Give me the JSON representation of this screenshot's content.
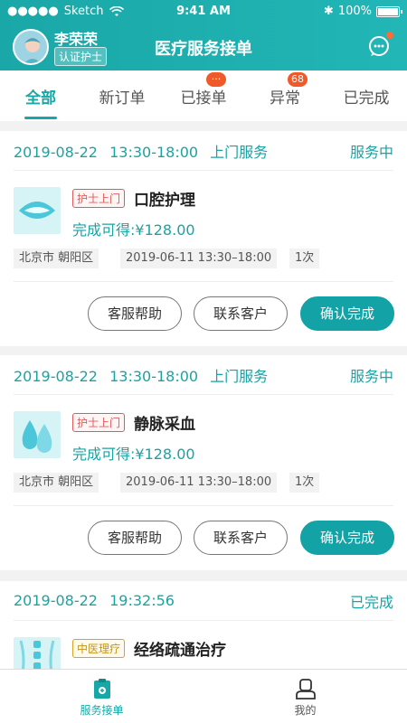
{
  "status_bar": {
    "carrier": "Sketch",
    "time": "9:41 AM",
    "battery": "100%"
  },
  "header": {
    "user_name": "李荣荣",
    "cert_badge": "认证护士",
    "title": "医疗服务接单"
  },
  "tabs": [
    {
      "label": "全部",
      "active": true,
      "badge": ""
    },
    {
      "label": "新订单",
      "active": false,
      "badge": ""
    },
    {
      "label": "已接单",
      "active": false,
      "badge": "···"
    },
    {
      "label": "异常",
      "active": false,
      "badge": "68"
    },
    {
      "label": "已完成",
      "active": false,
      "badge": ""
    }
  ],
  "orders": [
    {
      "date": "2019-08-22",
      "time": "13:30-18:00",
      "service_type": "上门服务",
      "status": "服务中",
      "tag": "护士上门",
      "name": "口腔护理",
      "earn": "完成可得:¥128.00",
      "city": "北京市",
      "district": "朝阳区",
      "appointment": "2019-06-11  13:30–18:00",
      "count": "1次",
      "buttons": {
        "help": "客服帮助",
        "contact": "联系客户",
        "confirm": "确认完成"
      }
    },
    {
      "date": "2019-08-22",
      "time": "13:30-18:00",
      "service_type": "上门服务",
      "status": "服务中",
      "tag": "护士上门",
      "name": "静脉采血",
      "earn": "完成可得:¥128.00",
      "city": "北京市",
      "district": "朝阳区",
      "appointment": "2019-06-11  13:30–18:00",
      "count": "1次",
      "buttons": {
        "help": "客服帮助",
        "contact": "联系客户",
        "confirm": "确认完成"
      }
    },
    {
      "date": "2019-08-22",
      "time": "19:32:56",
      "status": "已完成",
      "tag": "中医理疗",
      "name": "经络疏通治疗"
    }
  ],
  "bottom_nav": [
    {
      "label": "服务接单",
      "active": true
    },
    {
      "label": "我的",
      "active": false
    }
  ],
  "colors": {
    "brand": "#18a7a7",
    "badge": "#f05a28",
    "tag_red": "#e05a5a",
    "tag_gold": "#c49419"
  }
}
